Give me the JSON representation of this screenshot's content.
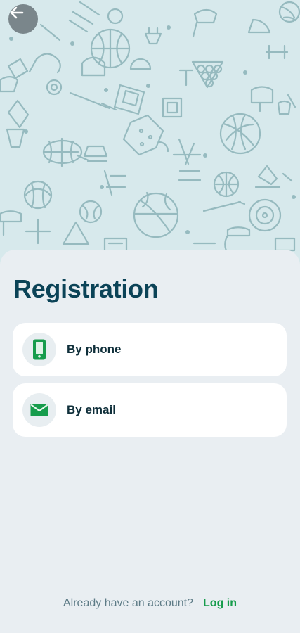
{
  "header": {
    "back_icon": "back-arrow-icon"
  },
  "registration": {
    "title": "Registration",
    "options": [
      {
        "label": "By phone",
        "icon": "phone-icon"
      },
      {
        "label": "By email",
        "icon": "mail-icon"
      }
    ]
  },
  "footer": {
    "prompt": "Already have an account?",
    "login_label": "Log in"
  },
  "theme": {
    "hero_background": "#d7e9ec",
    "hero_pattern": "#8fb6bb",
    "title_color": "#0b4357",
    "accent_green": "#169c4c",
    "muted_text": "#5d7b86"
  }
}
